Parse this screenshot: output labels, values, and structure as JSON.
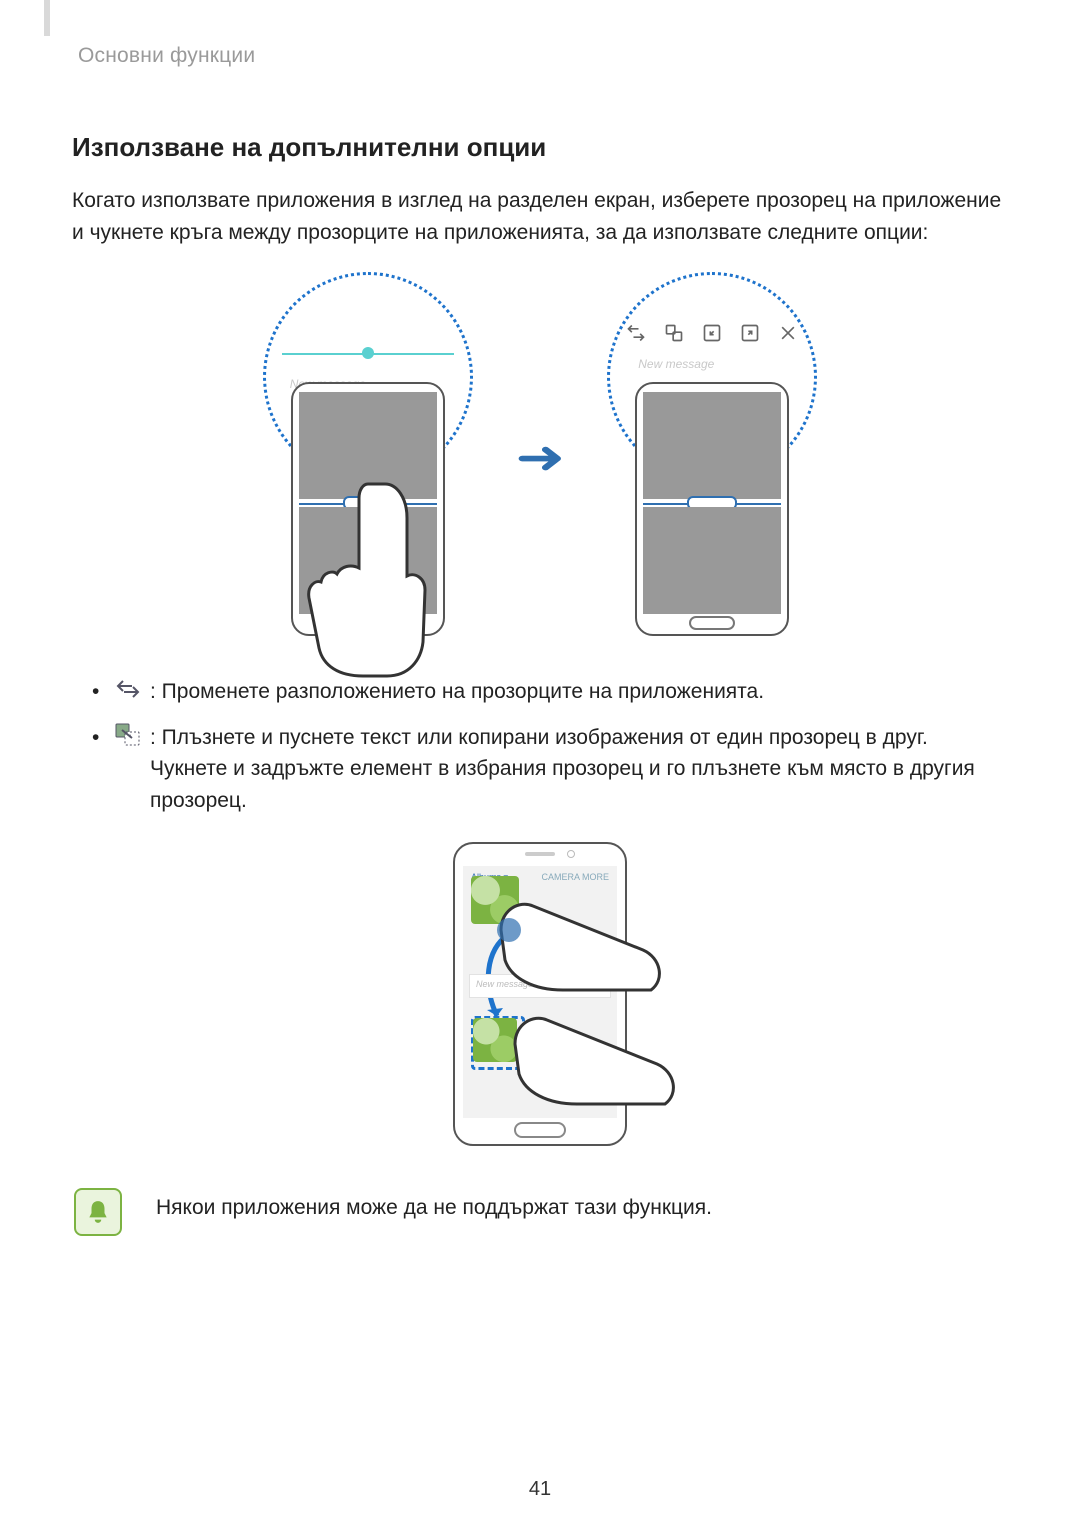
{
  "breadcrumb": "Основни функции",
  "section_title": "Използване на допълнителни опции",
  "lead": "Когато използвате приложения в изглед на разделен екран, изберете прозорец на приложение и чукнете кръга между прозорците на приложенията, за да използвате следните опции:",
  "callout_left_placeholder": "New message",
  "callout_right_placeholder": "New message",
  "toolbar_icons": [
    "swap-icon",
    "drag-content-icon",
    "minimize-icon",
    "maximize-icon",
    "close-icon"
  ],
  "list": [
    {
      "icon": "swap-windows-icon",
      "text": ": Променете разположението на прозорците на приложенията."
    },
    {
      "icon": "drag-content-icon",
      "text": ": Плъзнете и пуснете текст или копирани изображения от един прозорец в друг. Чукнете и задръжте елемент в избрания прозорец и го плъзнете към място в другия прозорец."
    }
  ],
  "gallery_header": {
    "left": "Albums ▾",
    "right": "CAMERA  MORE"
  },
  "mid_message": "New message",
  "note": "Някои приложения може да не поддържат тази функция.",
  "page_number": "41"
}
